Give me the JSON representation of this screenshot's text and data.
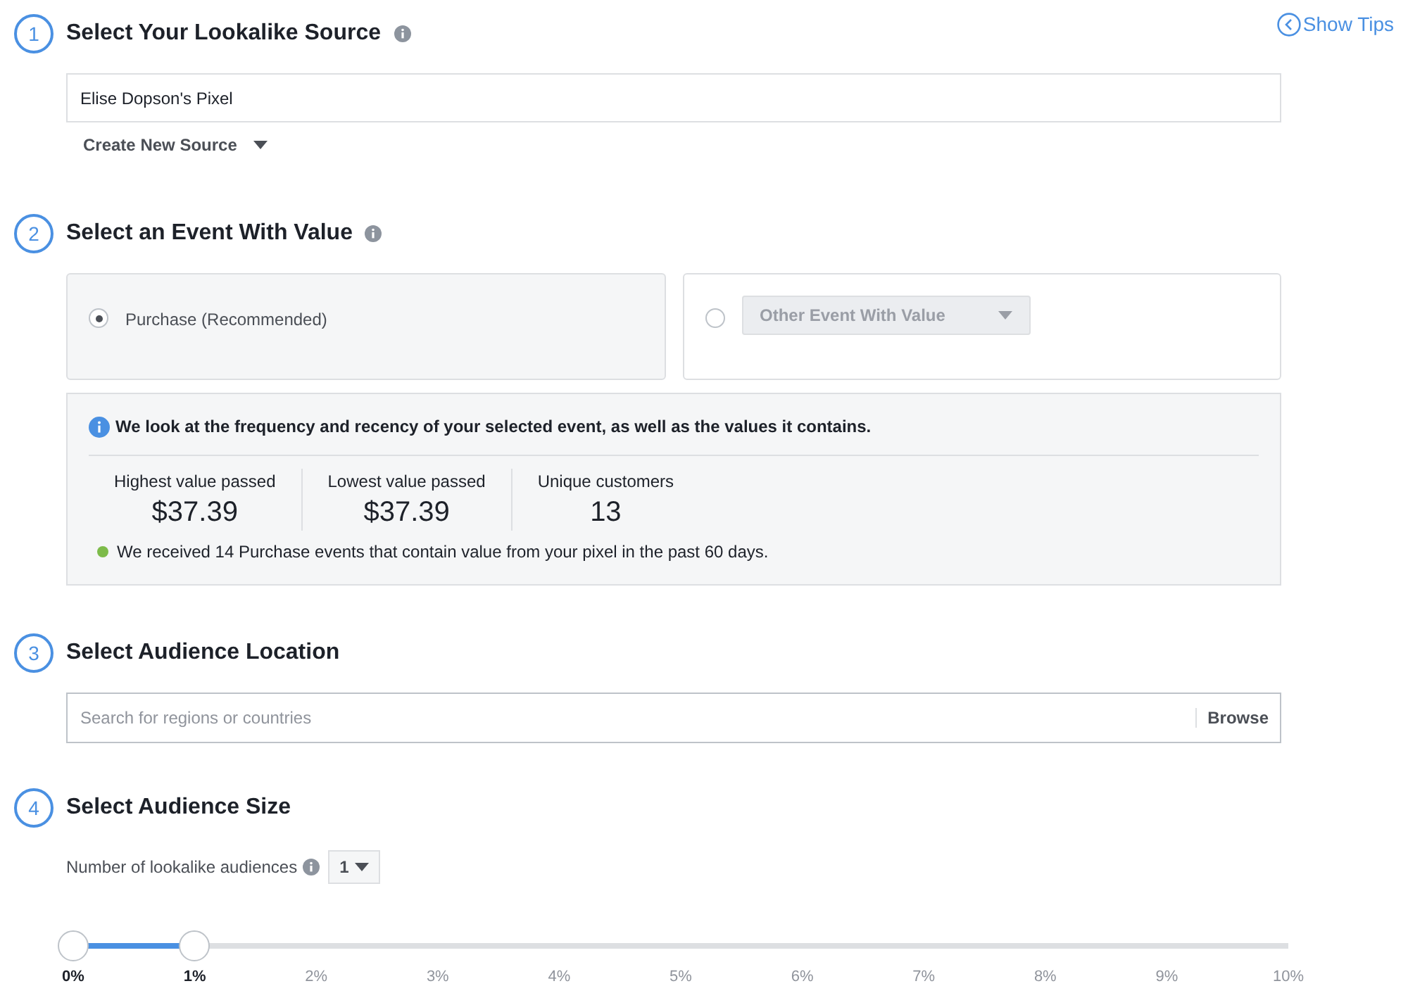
{
  "show_tips": "Show Tips",
  "sections": [
    {
      "number": "1",
      "title": "Select Your Lookalike Source",
      "info": true,
      "kind": "source",
      "value": "Elise Dopson's Pixel",
      "create_label": "Create New Source"
    },
    {
      "number": "2",
      "title": "Select an Event With Value",
      "info": true,
      "kind": "event",
      "options": [
        {
          "label": "Purchase (Recommended)",
          "selected": true,
          "disabled": false,
          "kind": "radio"
        },
        {
          "label": "Other Event With Value",
          "selected": false,
          "disabled": true,
          "kind": "dropdown"
        }
      ],
      "notice": "We look at the frequency and recency of your selected event, as well as the values it contains.",
      "stats": [
        {
          "label": "Highest value passed",
          "value": "$37.39"
        },
        {
          "label": "Lowest value passed",
          "value": "$37.39"
        },
        {
          "label": "Unique customers",
          "value": "13"
        }
      ],
      "status": {
        "text": "We received 14 Purchase events that contain value from your pixel in the past 60 days.",
        "color": "#7dbb4a"
      }
    },
    {
      "number": "3",
      "title": "Select Audience Location",
      "kind": "location",
      "placeholder": "Search for regions or countries",
      "browse": "Browse"
    },
    {
      "number": "4",
      "title": "Select Audience Size",
      "kind": "size",
      "count_label": "Number of lookalike audiences",
      "count_value": "1",
      "slider": {
        "level": 0.1,
        "ticks": [
          {
            "label": "0%",
            "selected": true
          },
          {
            "label": "1%",
            "selected": true
          },
          {
            "label": "2%",
            "selected": false
          },
          {
            "label": "3%",
            "selected": false
          },
          {
            "label": "4%",
            "selected": false
          },
          {
            "label": "5%",
            "selected": false
          },
          {
            "label": "6%",
            "selected": false
          },
          {
            "label": "7%",
            "selected": false
          },
          {
            "label": "8%",
            "selected": false
          },
          {
            "label": "9%",
            "selected": false
          },
          {
            "label": "10%",
            "selected": false
          }
        ]
      }
    }
  ]
}
